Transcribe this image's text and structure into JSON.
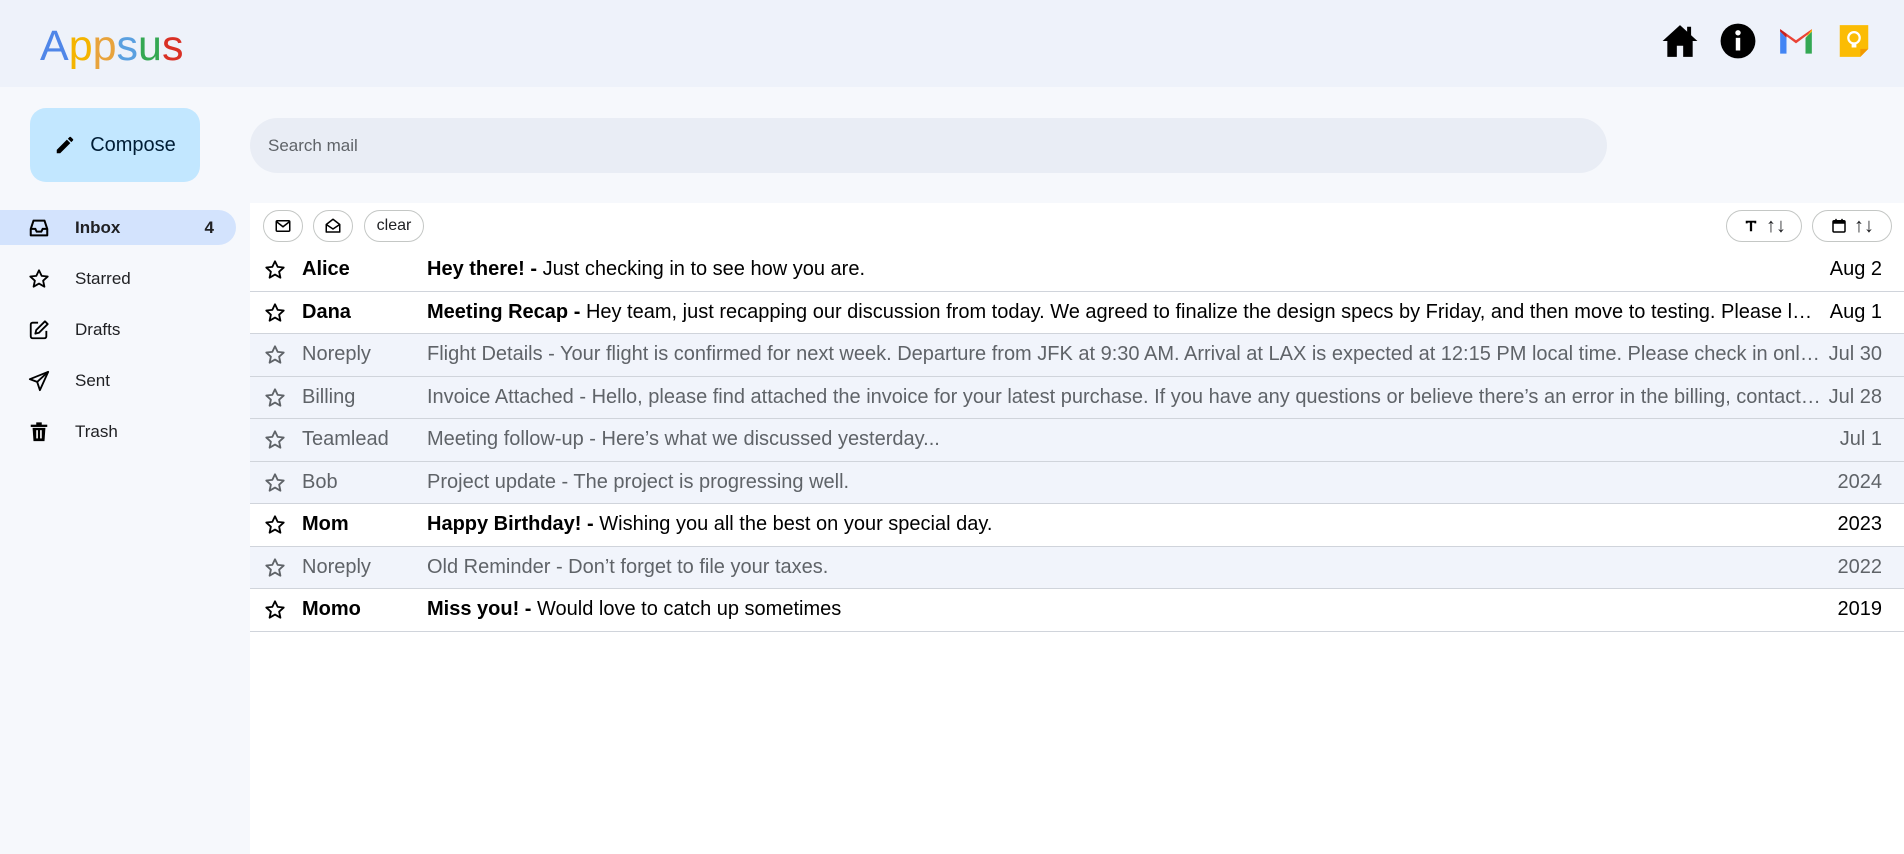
{
  "app": {
    "logo_letters": [
      {
        "ch": "A",
        "color": "#4f86e8"
      },
      {
        "ch": "p",
        "color": "#f4b400"
      },
      {
        "ch": "p",
        "color": "#e8a33c"
      },
      {
        "ch": "s",
        "color": "#5aa0e0"
      },
      {
        "ch": "u",
        "color": "#34a853"
      },
      {
        "ch": "s",
        "color": "#d93025"
      }
    ],
    "header_icons": [
      "home-icon",
      "info-icon",
      "gmail-icon",
      "keep-icon"
    ]
  },
  "compose": {
    "label": "Compose"
  },
  "search": {
    "placeholder": "Search mail"
  },
  "sidebar": {
    "items": [
      {
        "label": "Inbox",
        "count": "4",
        "icon": "inbox-icon"
      },
      {
        "label": "Starred",
        "count": "",
        "icon": "star-icon"
      },
      {
        "label": "Drafts",
        "count": "",
        "icon": "edit-icon"
      },
      {
        "label": "Sent",
        "count": "",
        "icon": "send-icon"
      },
      {
        "label": "Trash",
        "count": "",
        "icon": "trash-icon"
      }
    ]
  },
  "toolbar": {
    "clear_label": "clear",
    "sort_title_arrows": "↑↓",
    "sort_date_arrows": "↑↓"
  },
  "mails": [
    {
      "from": "Alice",
      "subject": "Hey there!",
      "body": "Just checking in to see how you are.",
      "date": "Aug 2",
      "read": false
    },
    {
      "from": "Dana",
      "subject": "Meeting Recap",
      "body": "Hey team, just recapping our discussion from today. We agreed to finalize the design specs by Friday, and then move to testing. Please let me know if I missed anything.",
      "date": "Aug 1",
      "read": false
    },
    {
      "from": "Noreply",
      "subject": "Flight Details",
      "body": "Your flight is confirmed for next week. Departure from JFK at 9:30 AM. Arrival at LAX is expected at 12:15 PM local time. Please check in online.",
      "date": "Jul 30",
      "read": true
    },
    {
      "from": "Billing",
      "subject": "Invoice Attached",
      "body": "Hello, please find attached the invoice for your latest purchase. If you have any questions or believe there’s an error in the billing, contact us.",
      "date": "Jul 28",
      "read": true
    },
    {
      "from": "Teamlead",
      "subject": "Meeting follow-up",
      "body": "Here’s what we discussed yesterday...",
      "date": "Jul 1",
      "read": true
    },
    {
      "from": "Bob",
      "subject": "Project update",
      "body": "The project is progressing well.",
      "date": "2024",
      "read": true
    },
    {
      "from": "Mom",
      "subject": "Happy Birthday!",
      "body": "Wishing you all the best on your special day.",
      "date": "2023",
      "read": false
    },
    {
      "from": "Noreply",
      "subject": "Old Reminder",
      "body": "Don’t forget to file your taxes.",
      "date": "2022",
      "read": true
    },
    {
      "from": "Momo",
      "subject": "Miss you!",
      "body": "Would love to catch up sometimes",
      "date": "2019",
      "read": false
    }
  ]
}
